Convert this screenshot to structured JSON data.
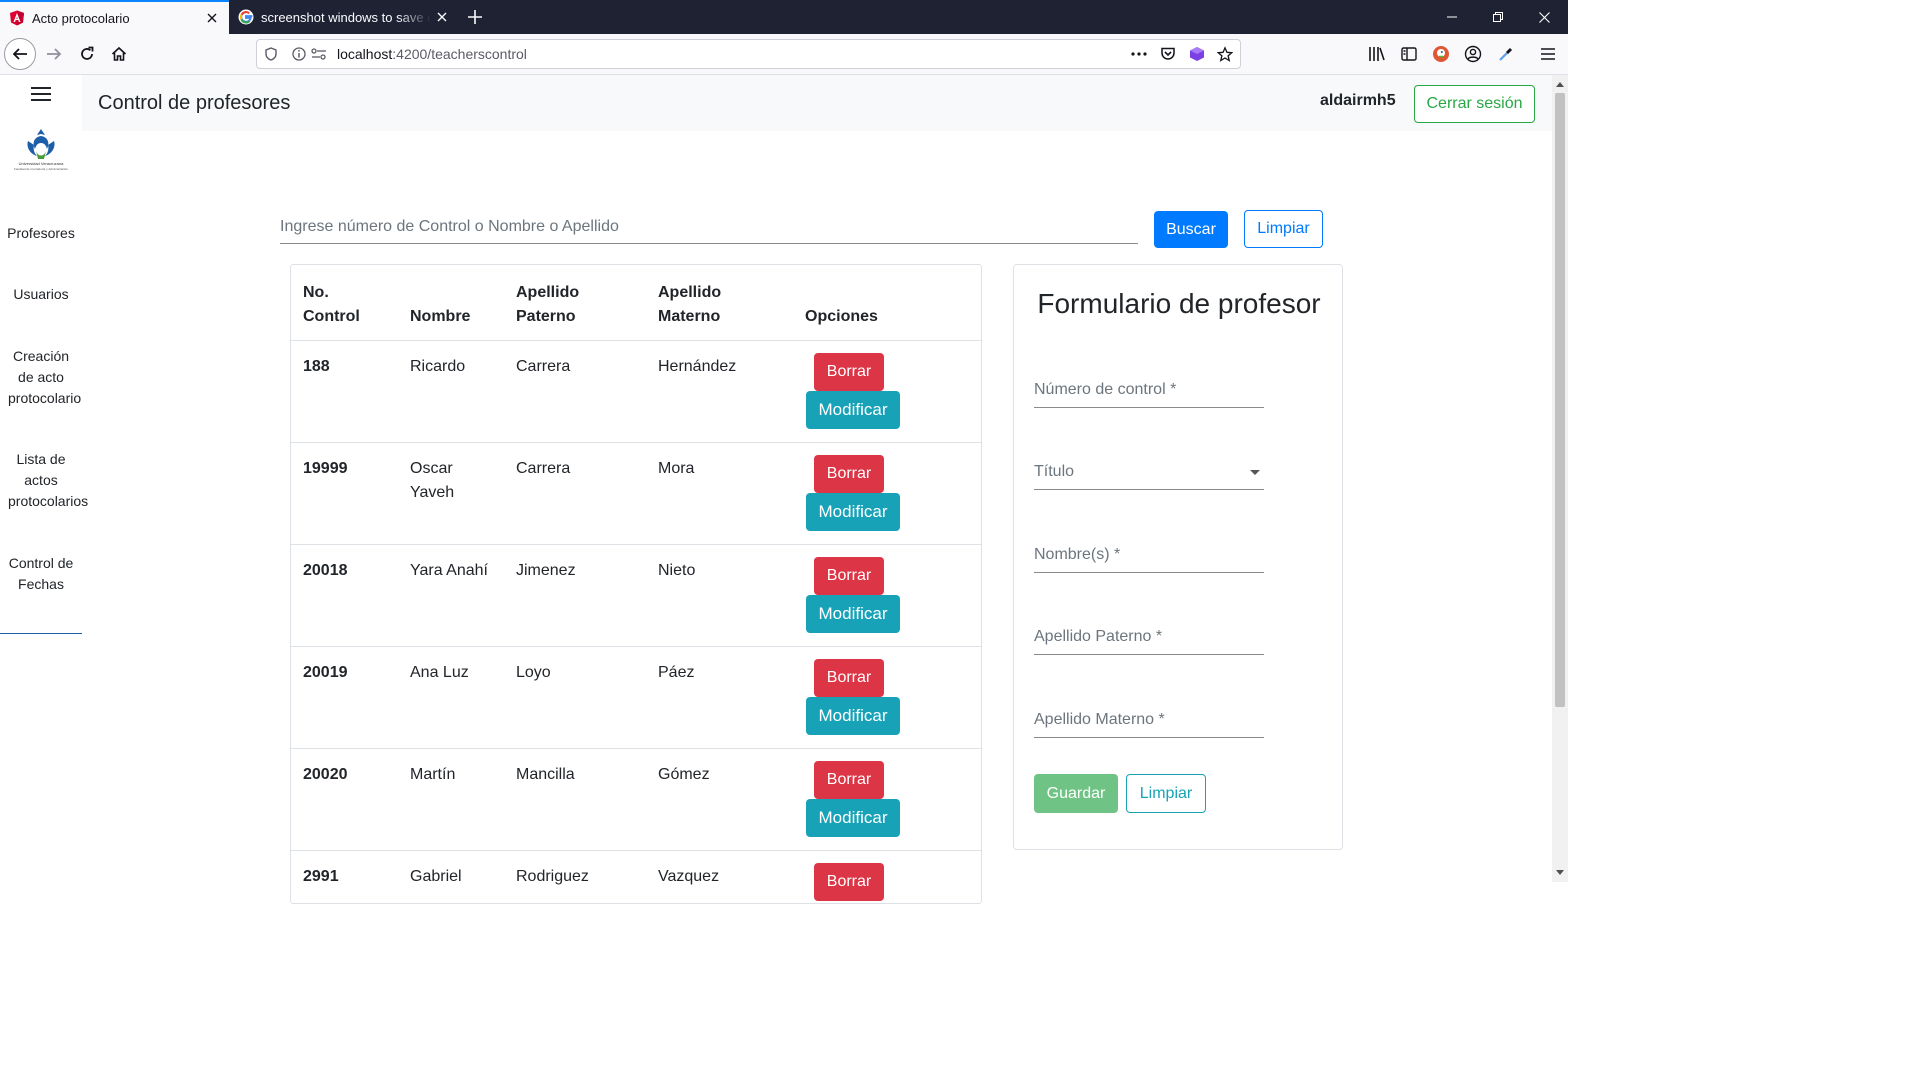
{
  "browser": {
    "tabs": [
      {
        "title": "Acto protocolario",
        "active": true,
        "icon": "angular-icon"
      },
      {
        "title": "screenshot windows to save on",
        "active": false,
        "icon": "google-icon"
      }
    ],
    "url": {
      "host": "localhost",
      "path": ":4200/teacherscontrol"
    }
  },
  "header": {
    "title": "Control de profesores",
    "username": "aldairmh5",
    "logout_label": "Cerrar sesión"
  },
  "sidebar": {
    "logo_lines": [
      "Universidad Veracruzana",
      "Facultad de Contaduría y Administración"
    ],
    "items": [
      {
        "label": "Profesores"
      },
      {
        "label": "Usuarios"
      },
      {
        "label": "Creación de acto protocolario"
      },
      {
        "label": "Lista de actos protocolarios"
      },
      {
        "label": "Control de Fechas"
      }
    ]
  },
  "search": {
    "placeholder": "Ingrese número de Control o Nombre o Apellido",
    "search_label": "Buscar",
    "clear_label": "Limpiar"
  },
  "table": {
    "headers": [
      "No. Control",
      "Nombre",
      "Apellido Paterno",
      "Apellido Materno",
      "Opciones"
    ],
    "delete_label": "Borrar",
    "edit_label": "Modificar",
    "rows": [
      {
        "control": "188",
        "nombre": "Ricardo",
        "paterno": "Carrera",
        "materno": "Hernández"
      },
      {
        "control": "19999",
        "nombre": "Oscar Yaveh",
        "paterno": "Carrera",
        "materno": "Mora"
      },
      {
        "control": "20018",
        "nombre": "Yara Anahí",
        "paterno": "Jimenez",
        "materno": "Nieto"
      },
      {
        "control": "20019",
        "nombre": "Ana Luz",
        "paterno": "Loyo",
        "materno": "Páez"
      },
      {
        "control": "20020",
        "nombre": "Martín",
        "paterno": "Mancilla",
        "materno": "Gómez"
      },
      {
        "control": "2991",
        "nombre": "Gabriel",
        "paterno": "Rodriguez",
        "materno": "Vazquez"
      }
    ]
  },
  "form": {
    "title": "Formulario de profesor",
    "fields": {
      "control": "Número de control *",
      "titulo": "Título",
      "nombre": "Nombre(s) *",
      "paterno": "Apellido Paterno *",
      "materno": "Apellido Materno *"
    },
    "save_label": "Guardar",
    "clear_label": "Limpiar"
  },
  "colors": {
    "primary": "#007bff",
    "danger": "#dc3545",
    "info": "#17a2b8",
    "success": "#28a745",
    "success_disabled": "#6fc384"
  }
}
